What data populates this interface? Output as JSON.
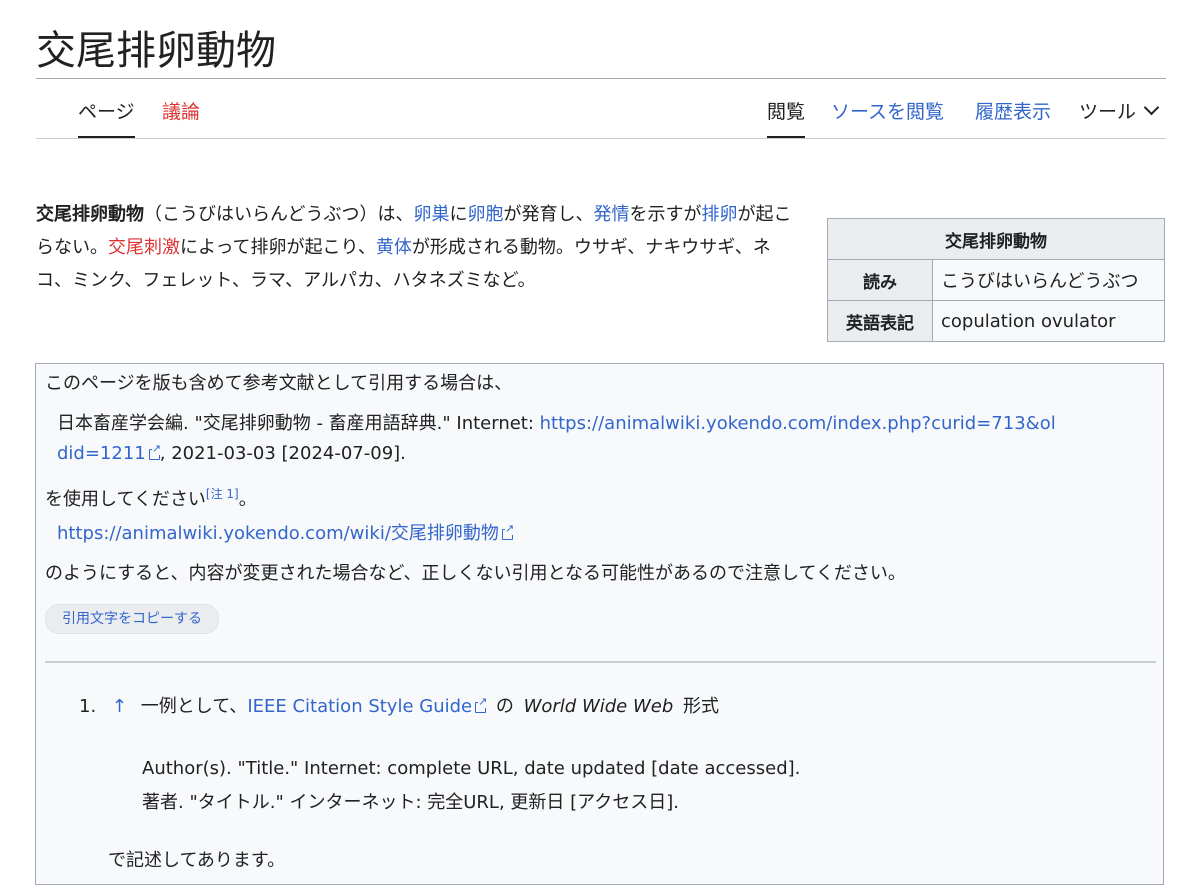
{
  "page": {
    "title": "交尾排卵動物"
  },
  "tabs": {
    "left": [
      {
        "label": "ページ"
      },
      {
        "label": "議論"
      }
    ],
    "right": [
      {
        "label": "閲覧"
      },
      {
        "label": "ソースを閲覧"
      },
      {
        "label": "履歴表示"
      },
      {
        "label": "ツール"
      }
    ]
  },
  "intro": {
    "bold_term": "交尾排卵動物",
    "t1": "（こうびはいらんどうぶつ）は、",
    "l1": "卵巣",
    "t2": "に",
    "l2": "卵胞",
    "t3": "が発育し、",
    "l3": "発情",
    "t4": "を示すが",
    "l4": "排卵",
    "t5": "が起こらない。",
    "l5": "交尾刺激",
    "t6": "によって排卵が起こり、",
    "l6": "黄体",
    "t7": "が形成される動物。ウサギ、ナキウサギ、ネコ、ミンク、フェレット、ラマ、アルパカ、ハタネズミなど。"
  },
  "infobox": {
    "caption": "交尾排卵動物",
    "rows": [
      {
        "label": "読み",
        "value": "こうびはいらんどうぶつ"
      },
      {
        "label": "英語表記",
        "value": "copulation ovulator"
      }
    ]
  },
  "citation": {
    "intro": "このページを版も含めて参考文献として引用する場合は、",
    "ref_text": "日本畜産学会編. \"交尾排卵動物 - 畜産用語辞典.\" Internet: ",
    "ref_url_part1": "https://animalwiki.yokendo.com/index.php?curid=713&ol",
    "ref_url_part2": "did=1211",
    "ref_dates": ", 2021-03-03 [2024-07-09].",
    "use_text": "を使用してください",
    "note_ref": "[注 1]",
    "use_end": "。",
    "plain_url": "https://animalwiki.yokendo.com/wiki/交尾排卵動物",
    "warning": "のようにすると、内容が変更された場合など、正しくない引用となる可能性があるので注意してください。",
    "copy_button": "引用文字をコピーする"
  },
  "notes": {
    "number": "1.",
    "backlink": "↑",
    "t1": "一例として、",
    "link": "IEEE Citation Style Guide",
    "t2": "の",
    "italic": "World Wide Web",
    "t3": "形式",
    "example_en": "Author(s). \"Title.\" Internet: complete URL, date updated [date accessed].",
    "example_ja": "著者. \"タイトル.\" インターネット: 完全URL, 更新日 [アクセス日].",
    "ending": "で記述してあります。"
  }
}
